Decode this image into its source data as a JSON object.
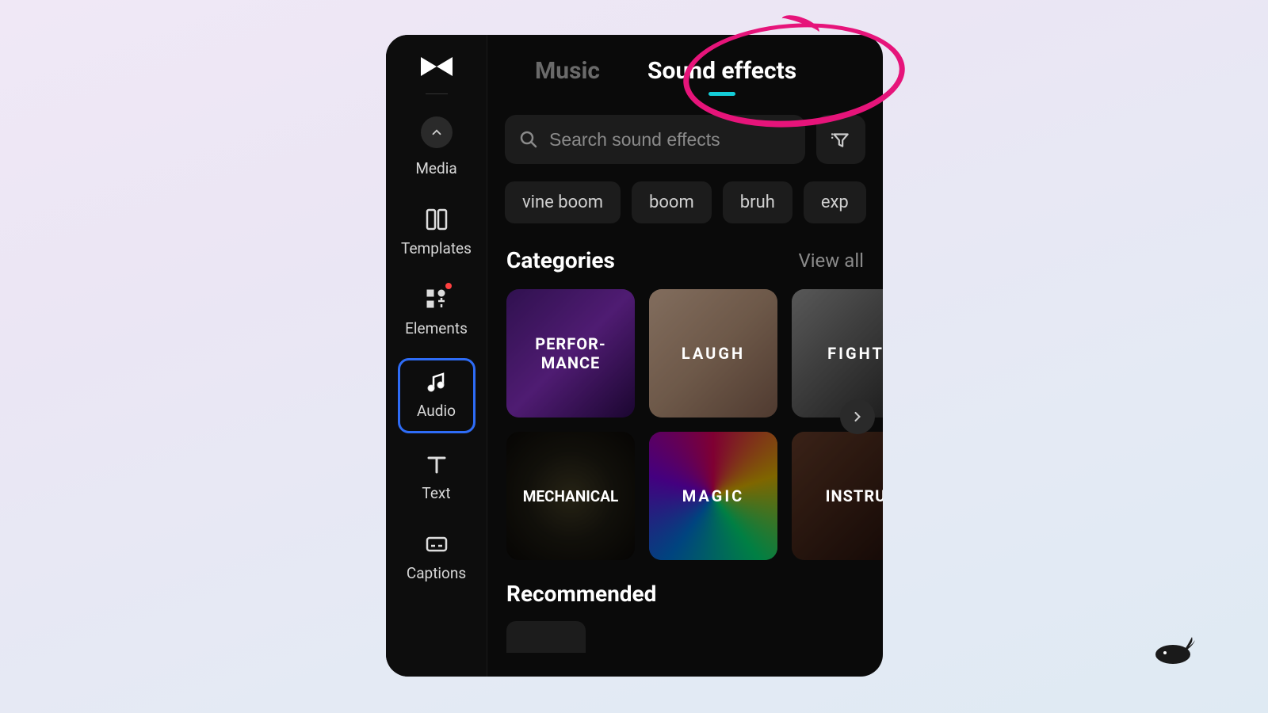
{
  "sidebar": {
    "items": [
      {
        "label": "Media"
      },
      {
        "label": "Templates"
      },
      {
        "label": "Elements"
      },
      {
        "label": "Audio"
      },
      {
        "label": "Text"
      },
      {
        "label": "Captions"
      }
    ]
  },
  "tabs": {
    "music": "Music",
    "sound_effects": "Sound effects"
  },
  "search": {
    "placeholder": "Search sound effects"
  },
  "chips": [
    "vine boom",
    "boom",
    "bruh",
    "exp"
  ],
  "sections": {
    "categories_title": "Categories",
    "view_all": "View all",
    "recommended_title": "Recommended"
  },
  "categories": [
    {
      "label": "PERFOR-\nMANCE"
    },
    {
      "label": "LAUGH"
    },
    {
      "label": "FIGHT"
    },
    {
      "label": "MECHANICAL"
    },
    {
      "label": "MAGIC"
    },
    {
      "label": "INSTRU"
    }
  ]
}
